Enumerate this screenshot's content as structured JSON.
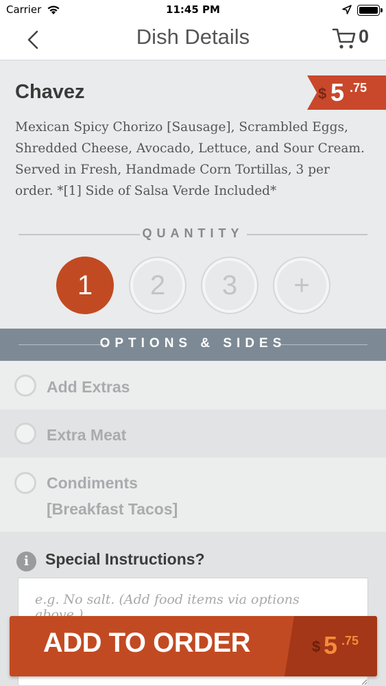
{
  "status_bar": {
    "carrier": "Carrier",
    "time": "11:45 PM"
  },
  "nav": {
    "title": "Dish Details",
    "cart_count": "0"
  },
  "dish": {
    "name": "Chavez",
    "price": {
      "currency": "$",
      "whole": "5",
      "cents": ".75"
    },
    "description": "Mexican Spicy Chorizo [Sausage], Scrambled Eggs, Shredded Cheese, Avocado, Lettuce, and Sour Cream. Served in Fresh, Handmade Corn Tortillas, 3 per order. *[1] Side of Salsa Verde Included*"
  },
  "quantity": {
    "header": "QUANTITY",
    "options": [
      "1",
      "2",
      "3",
      "+"
    ],
    "selected": "1"
  },
  "options_section": {
    "header": "OPTIONS & SIDES",
    "items": [
      {
        "label": "Add Extras",
        "checked": false
      },
      {
        "label": "Extra Meat",
        "checked": false
      },
      {
        "label": "Condiments",
        "sub": "[Breakfast Tacos]",
        "checked": false
      }
    ]
  },
  "instructions": {
    "label": "Special Instructions?",
    "placeholder": "e.g. No salt. (Add food items via options above.)"
  },
  "add_to_order": {
    "label": "ADD TO ORDER",
    "currency": "$",
    "whole": "5",
    "cents": ".75"
  },
  "colors": {
    "accent": "#c24a22",
    "accent_dark": "#a43717",
    "price_tag": "#c9482b",
    "section_header": "#7d8a95"
  }
}
